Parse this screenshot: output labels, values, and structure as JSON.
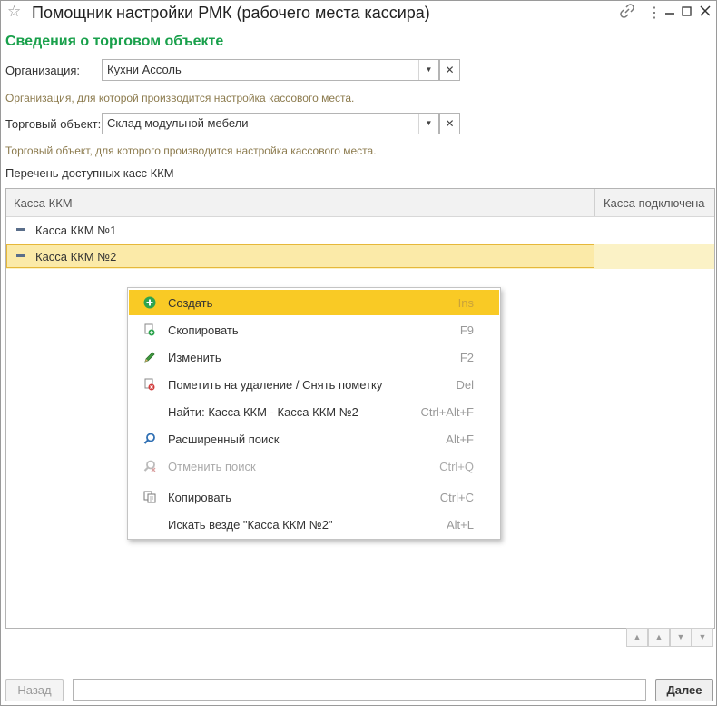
{
  "window": {
    "title": "Помощник настройки РМК (рабочего места кассира)"
  },
  "section_title": "Сведения о торговом объекте",
  "organization": {
    "label": "Организация:",
    "value": "Кухни Ассоль",
    "hint": "Организация, для которой производится настройка кассового места."
  },
  "trade_object": {
    "label": "Торговый объект:",
    "value": "Склад модульной мебели",
    "hint": "Торговый объект, для которого производится настройка кассового места."
  },
  "list": {
    "title": "Перечень доступных касс ККМ",
    "columns": [
      "Касса ККМ",
      "Касса подключена"
    ],
    "rows": [
      {
        "name": "Касса ККМ №1",
        "connected": ""
      },
      {
        "name": "Касса ККМ №2",
        "connected": ""
      }
    ]
  },
  "context_menu": {
    "items": [
      {
        "label": "Создать",
        "shortcut": "Ins",
        "icon": "plus-circle-icon"
      },
      {
        "label": "Скопировать",
        "shortcut": "F9",
        "icon": "copy-doc-icon"
      },
      {
        "label": "Изменить",
        "shortcut": "F2",
        "icon": "pencil-icon"
      },
      {
        "label": "Пометить на удаление / Снять пометку",
        "shortcut": "Del",
        "icon": "delete-mark-icon"
      },
      {
        "label": "Найти: Касса ККМ - Касса ККМ №2",
        "shortcut": "Ctrl+Alt+F",
        "icon": ""
      },
      {
        "label": "Расширенный поиск",
        "shortcut": "Alt+F",
        "icon": "search-icon"
      },
      {
        "label": "Отменить поиск",
        "shortcut": "Ctrl+Q",
        "icon": "cancel-search-icon"
      },
      {
        "label": "Копировать",
        "shortcut": "Ctrl+C",
        "icon": "clipboard-icon"
      },
      {
        "label": "Искать везде \"Касса ККМ №2\"",
        "shortcut": "Alt+L",
        "icon": ""
      }
    ]
  },
  "footer": {
    "back_label": "Назад",
    "next_label": "Далее"
  },
  "colors": {
    "accent_green": "#19a04b",
    "highlight_yellow": "#f9ca25",
    "hint_brown": "#8c7b4e"
  }
}
